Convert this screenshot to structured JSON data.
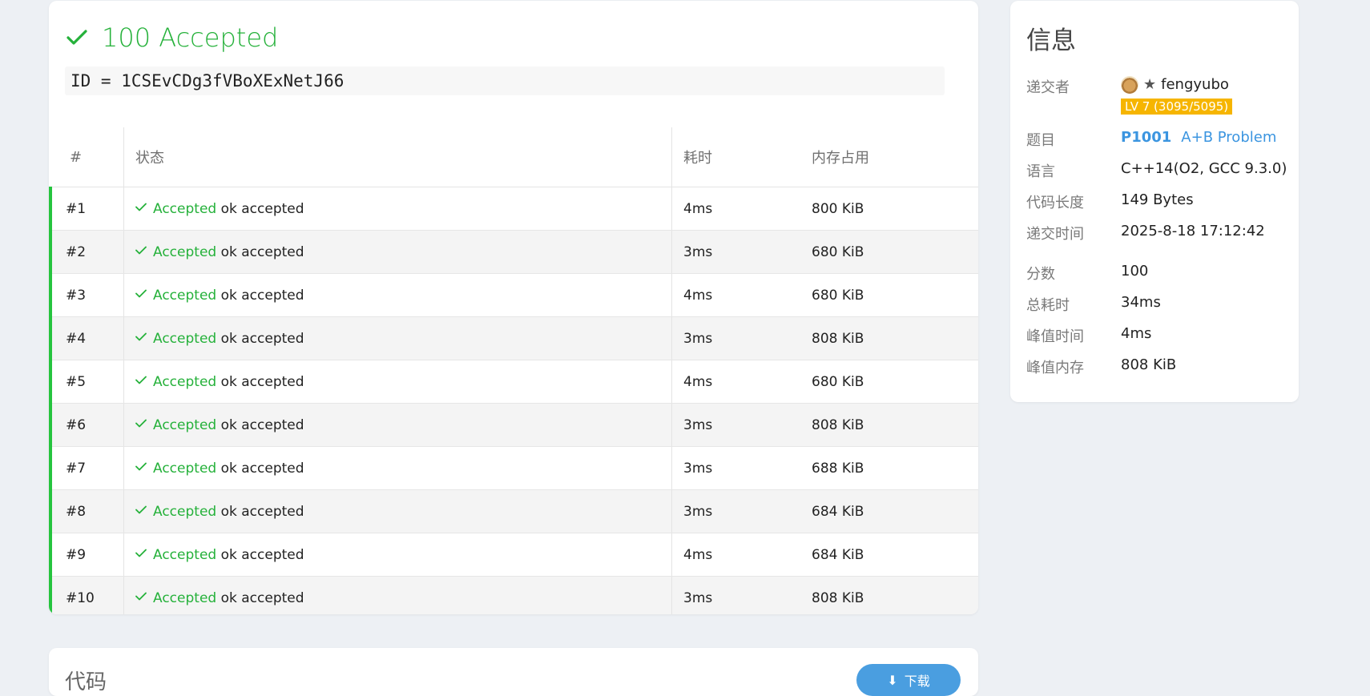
{
  "submission": {
    "score": "100",
    "status": "Accepted",
    "id_line": "ID = 1CSEvCDg3fVBoXExNetJ66"
  },
  "table": {
    "headers": [
      "#",
      "状态",
      "耗时",
      "内存占用"
    ],
    "rows": [
      {
        "num": "#1",
        "status": "Accepted",
        "message": "ok accepted",
        "time": "4ms",
        "memory": "800 KiB"
      },
      {
        "num": "#2",
        "status": "Accepted",
        "message": "ok accepted",
        "time": "3ms",
        "memory": "680 KiB"
      },
      {
        "num": "#3",
        "status": "Accepted",
        "message": "ok accepted",
        "time": "4ms",
        "memory": "680 KiB"
      },
      {
        "num": "#4",
        "status": "Accepted",
        "message": "ok accepted",
        "time": "3ms",
        "memory": "808 KiB"
      },
      {
        "num": "#5",
        "status": "Accepted",
        "message": "ok accepted",
        "time": "4ms",
        "memory": "680 KiB"
      },
      {
        "num": "#6",
        "status": "Accepted",
        "message": "ok accepted",
        "time": "3ms",
        "memory": "808 KiB"
      },
      {
        "num": "#7",
        "status": "Accepted",
        "message": "ok accepted",
        "time": "3ms",
        "memory": "688 KiB"
      },
      {
        "num": "#8",
        "status": "Accepted",
        "message": "ok accepted",
        "time": "3ms",
        "memory": "684 KiB"
      },
      {
        "num": "#9",
        "status": "Accepted",
        "message": "ok accepted",
        "time": "4ms",
        "memory": "684 KiB"
      },
      {
        "num": "#10",
        "status": "Accepted",
        "message": "ok accepted",
        "time": "3ms",
        "memory": "808 KiB"
      }
    ]
  },
  "info": {
    "title": "信息",
    "submitter_label": "递交者",
    "submitter_name": "fengyubo",
    "level_badge": "LV 7 (3095/5095)",
    "problem_label": "题目",
    "problem_id": "P1001",
    "problem_name": "A+B Problem",
    "language_label": "语言",
    "language": "C++14(O2, GCC 9.3.0)",
    "code_length_label": "代码长度",
    "code_length": "149 Bytes",
    "submit_time_label": "递交时间",
    "submit_time": "2025-8-18 17:12:42",
    "score_label": "分数",
    "score": "100",
    "total_time_label": "总耗时",
    "total_time": "34ms",
    "peak_time_label": "峰值时间",
    "peak_time": "4ms",
    "peak_memory_label": "峰值内存",
    "peak_memory": "808 KiB"
  },
  "code_section": {
    "title": "代码",
    "download_label": "下载"
  },
  "colors": {
    "accepted": "#25b13a",
    "link": "#3b95e0",
    "level_badge": "#f6b500"
  }
}
